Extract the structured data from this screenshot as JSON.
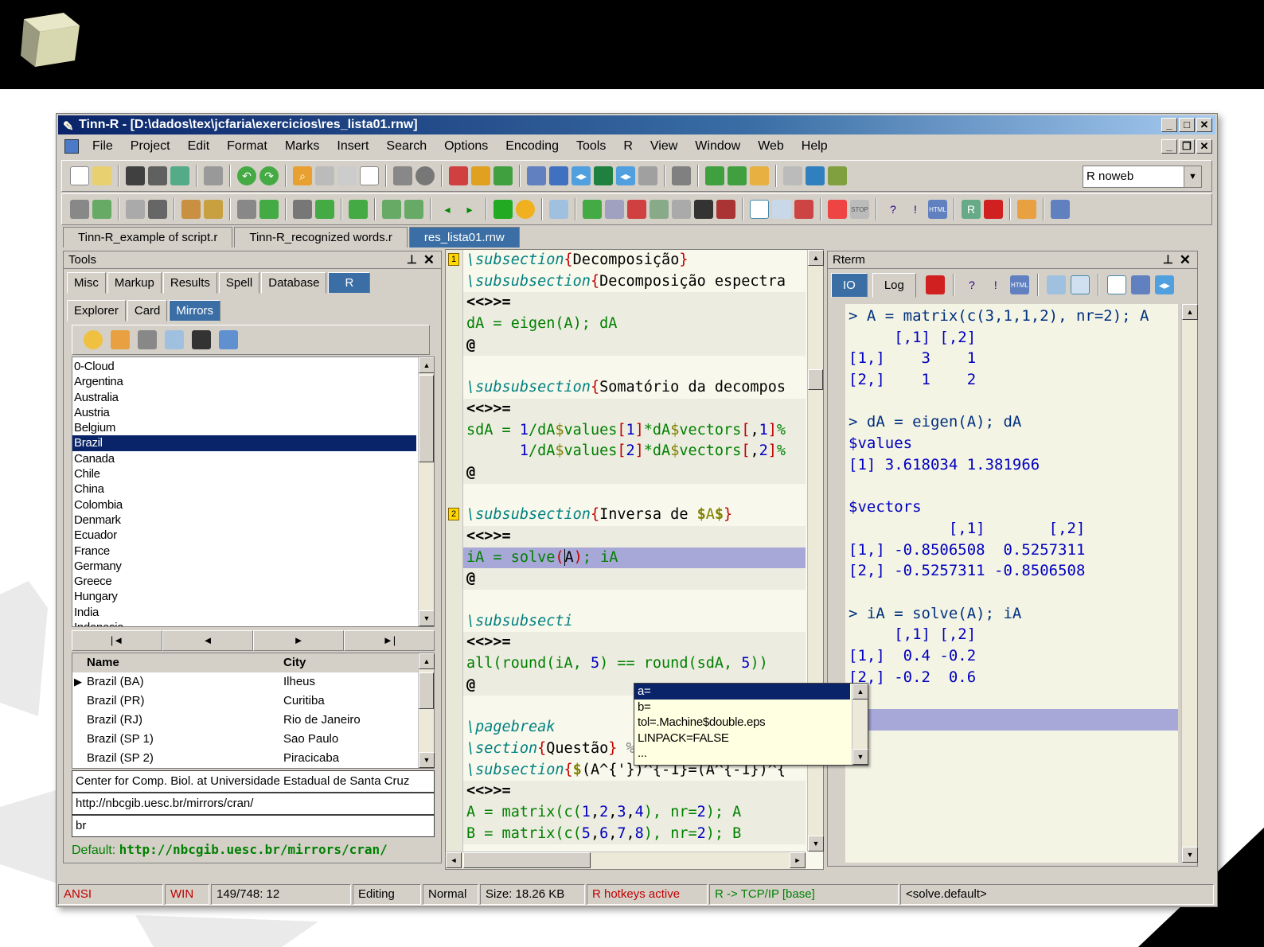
{
  "window": {
    "title": "Tinn-R - [D:\\dados\\tex\\jcfaria\\exercicios\\res_lista01.rnw]",
    "min": "_",
    "max": "□",
    "close": "✕"
  },
  "menu": [
    "File",
    "Project",
    "Edit",
    "Format",
    "Marks",
    "Insert",
    "Search",
    "Options",
    "Encoding",
    "Tools",
    "R",
    "View",
    "Window",
    "Web",
    "Help"
  ],
  "toolbar": {
    "mode_select": "R noweb"
  },
  "file_tabs": [
    "Tinn-R_example of script.r",
    "Tinn-R_recognized words.r",
    "res_lista01.rnw"
  ],
  "tools": {
    "title": "Tools",
    "tabs": [
      "Misc",
      "Markup",
      "Results",
      "Spell",
      "Database",
      "R"
    ],
    "subtabs": [
      "Explorer",
      "Card",
      "Mirrors"
    ],
    "countries": [
      "0-Cloud",
      "Argentina",
      "Australia",
      "Austria",
      "Belgium",
      "Brazil",
      "Canada",
      "Chile",
      "China",
      "Colombia",
      "Denmark",
      "Ecuador",
      "France",
      "Germany",
      "Greece",
      "Hungary",
      "India",
      "Indonesia"
    ],
    "selected_country": "Brazil",
    "nav": [
      "|◄",
      "◄",
      "►",
      "►|"
    ],
    "grid_headers": [
      "Name",
      "City"
    ],
    "grid_rows": [
      [
        "Brazil (BA)",
        "Ilheus"
      ],
      [
        "Brazil (PR)",
        "Curitiba"
      ],
      [
        "Brazil (RJ)",
        "Rio de Janeiro"
      ],
      [
        "Brazil (SP 1)",
        "Sao Paulo"
      ],
      [
        "Brazil (SP 2)",
        "Piracicaba"
      ]
    ],
    "host": "Center for Comp. Biol. at Universidade Estadual de Santa Cruz",
    "url": "http://nbcgib.uesc.br/mirrors/cran/",
    "code": "br",
    "default_label": "Default:",
    "default_url": "http://nbcgib.uesc.br/mirrors/cran/"
  },
  "editor": {
    "bookmarks": [
      "1",
      "2"
    ],
    "popup": [
      "a=",
      "b=",
      "tol=.Machine$double.eps",
      "LINPACK=FALSE",
      "..."
    ]
  },
  "rterm": {
    "title": "Rterm",
    "tabs": [
      "IO",
      "Log"
    ],
    "lines": [
      "> A = matrix(c(3,1,1,2), nr=2); A",
      "     [,1] [,2]",
      "[1,]    3    1",
      "[2,]    1    2",
      "",
      "> dA = eigen(A); dA",
      "$values",
      "[1] 3.618034 1.381966",
      "",
      "$vectors",
      "           [,1]       [,2]",
      "[1,] -0.8506508  0.5257311",
      "[2,] -0.5257311 -0.8506508",
      "",
      "> iA = solve(A); iA",
      "     [,1] [,2]",
      "[1,]  0.4 -0.2",
      "[2,] -0.2  0.6",
      "",
      ">"
    ]
  },
  "status": [
    "ANSI",
    "WIN",
    "149/748: 12",
    "Editing",
    "Normal",
    "Size: 18.26 KB",
    "R hotkeys active",
    "R -> TCP/IP [base]",
    "<solve.default>"
  ],
  "colors": {
    "accent": "#3a6ea5",
    "selection": "#0a246a",
    "highlight": "#a8a8d8",
    "status_red": "#c00000",
    "status_green": "#008000"
  }
}
